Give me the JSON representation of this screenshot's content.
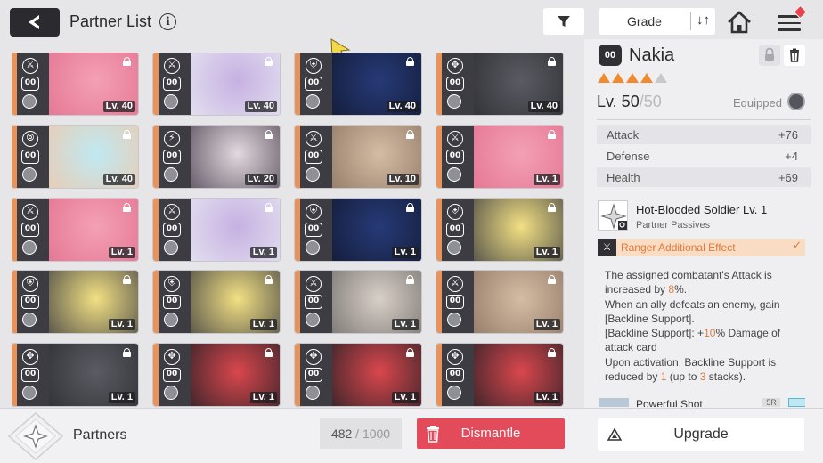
{
  "header": {
    "title": "Partner List",
    "info_glyph": "i",
    "grade_label": "Grade",
    "sort_glyph": "↓↑"
  },
  "cards": [
    {
      "rank": "00",
      "level": "Lv. 40",
      "cls": "⚔",
      "art": [
        "#f3a0b5",
        "#e36f8d"
      ],
      "edge": "#e8935b"
    },
    {
      "rank": "00",
      "level": "Lv. 40",
      "cls": "⚔",
      "art": [
        "#c6b1e2",
        "#e9e9f2"
      ],
      "edge": "#e8935b"
    },
    {
      "rank": "00",
      "level": "Lv. 40",
      "cls": "⛨",
      "art": [
        "#263a77",
        "#111830"
      ],
      "edge": "#e8935b"
    },
    {
      "rank": "00",
      "level": "Lv. 40",
      "cls": "✥",
      "art": [
        "#5b5b63",
        "#2a2a30"
      ],
      "edge": "#e8935b"
    },
    {
      "rank": "00",
      "level": "Lv. 40",
      "cls": "⦾",
      "art": [
        "#bfe9f2",
        "#f2c6a8"
      ],
      "edge": "#e8935b"
    },
    {
      "rank": "00",
      "level": "Lv. 20",
      "cls": "⚡",
      "art": [
        "#e3d9df",
        "#4a4250"
      ],
      "edge": "#e8935b"
    },
    {
      "rank": "00",
      "level": "Lv. 10",
      "cls": "⚔",
      "art": [
        "#d4bca4",
        "#8a7260"
      ],
      "edge": "#e8935b"
    },
    {
      "rank": "00",
      "level": "Lv. 1",
      "cls": "⚔",
      "art": [
        "#f3a0b5",
        "#e36f8d"
      ],
      "edge": "#e8935b"
    },
    {
      "rank": "00",
      "level": "Lv. 1",
      "cls": "⚔",
      "art": [
        "#f3a0b5",
        "#e36f8d"
      ],
      "edge": "#e8935b"
    },
    {
      "rank": "00",
      "level": "Lv. 1",
      "cls": "⚔",
      "art": [
        "#c6b1e2",
        "#e9e9f2"
      ],
      "edge": "#e8935b"
    },
    {
      "rank": "00",
      "level": "Lv. 1",
      "cls": "⛨",
      "art": [
        "#263a77",
        "#111830"
      ],
      "edge": "#e8935b"
    },
    {
      "rank": "00",
      "level": "Lv. 1",
      "cls": "⛨",
      "art": [
        "#f2e083",
        "#3a3a40"
      ],
      "edge": "#e8935b"
    },
    {
      "rank": "00",
      "level": "Lv. 1",
      "cls": "⛨",
      "art": [
        "#f2e083",
        "#3a3a40"
      ],
      "edge": "#e8935b"
    },
    {
      "rank": "00",
      "level": "Lv. 1",
      "cls": "⛨",
      "art": [
        "#f2e083",
        "#3a3a40"
      ],
      "edge": "#e8935b"
    },
    {
      "rank": "00",
      "level": "Lv. 1",
      "cls": "⚔",
      "art": [
        "#d8d0c8",
        "#6e6a66"
      ],
      "edge": "#e8935b"
    },
    {
      "rank": "00",
      "level": "Lv. 1",
      "cls": "⚔",
      "art": [
        "#d4bca4",
        "#8a7260"
      ],
      "edge": "#e8935b"
    },
    {
      "rank": "00",
      "level": "Lv. 1",
      "cls": "✥",
      "art": [
        "#5b5b63",
        "#2a2a30"
      ],
      "edge": "#e8935b"
    },
    {
      "rank": "00",
      "level": "Lv. 1",
      "cls": "✥",
      "art": [
        "#d9474d",
        "#1f1f24"
      ],
      "edge": "#e8935b"
    },
    {
      "rank": "00",
      "level": "Lv. 1",
      "cls": "✥",
      "art": [
        "#d9474d",
        "#1f1f24"
      ],
      "edge": "#e8935b"
    },
    {
      "rank": "00",
      "level": "Lv. 1",
      "cls": "✥",
      "art": [
        "#d9474d",
        "#1f1f24"
      ],
      "edge": "#e8935b"
    }
  ],
  "detail": {
    "rank": "00",
    "name": "Nakia",
    "stars_on": 4,
    "stars_total": 5,
    "level_prefix": "Lv. 50",
    "level_sep": "/",
    "level_max": "50",
    "equipped_label": "Equipped",
    "stats": [
      {
        "key": "Attack",
        "value": "+76"
      },
      {
        "key": "Defense",
        "value": "+4"
      },
      {
        "key": "Health",
        "value": "+69"
      }
    ],
    "passive_title": "Hot-Blooded Soldier Lv. 1",
    "passive_subtitle": "Partner Passives",
    "effect_label": "Ranger Additional Effect",
    "effect_check": "✓",
    "desc": {
      "l1a": "The assigned combatant's Attack is increased by ",
      "l1v": "8",
      "l1b": "%.",
      "l2": "When an ally defeats an enemy, gain [Backline Support].",
      "l3a": "[Backline Support]: +",
      "l3v": "10",
      "l3b": "% Damage of attack card",
      "l4a": "Upon activation, Backline Support is reduced by ",
      "l4v": "1",
      "l4b": " (up to ",
      "l4v2": "3",
      "l4c": " stacks)."
    },
    "next_skill_label": "Powerful Shot",
    "next_skill_badge": "5R"
  },
  "bottom": {
    "partners_label": "Partners",
    "count_current": "482",
    "count_sep": " / ",
    "count_total": "1000",
    "dismantle_label": "Dismantle",
    "upgrade_label": "Upgrade"
  },
  "icons": {
    "back": "back-arrow-icon",
    "filter": "filter-icon",
    "home": "home-icon",
    "menu": "menu-icon",
    "lock": "lock-icon",
    "trash": "trash-icon"
  },
  "colors": {
    "accent_orange": "#e17a3a",
    "dismantle_red": "#e34a5a",
    "star": "#f08a2e"
  }
}
